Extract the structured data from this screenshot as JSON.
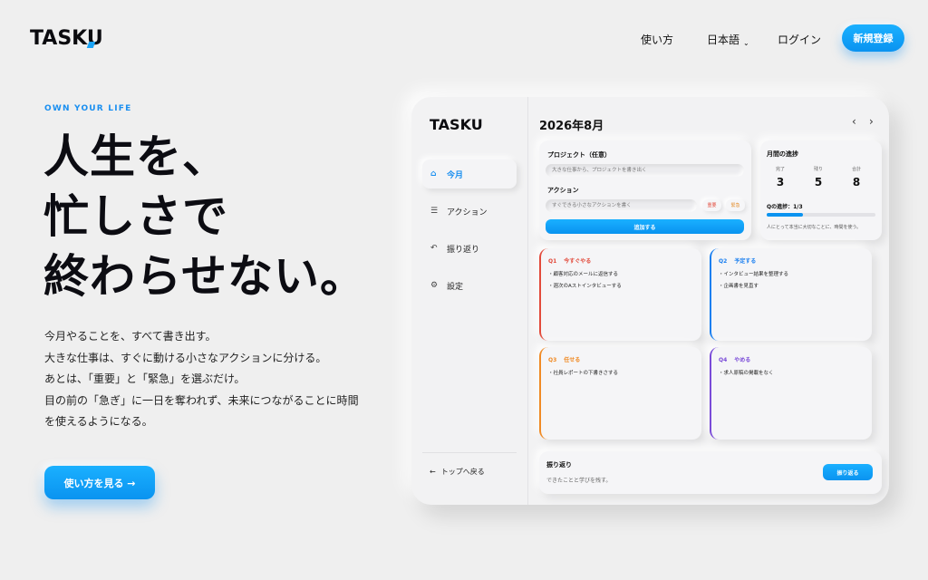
{
  "brand": {
    "logo_pre": "TASK",
    "logo_accent": "U"
  },
  "nav": {
    "how_to": "使い方",
    "language": "日本語",
    "login": "ログイン",
    "signup": "新規登録"
  },
  "hero": {
    "tagline": "OWN YOUR LIFE",
    "headline": [
      "人生を、",
      "忙しさで",
      "終わらせない。"
    ],
    "description": [
      "今月やることを、すべて書き出す。",
      "大きな仕事は、すぐに動ける小さなアクションに分ける。",
      "あとは、「重要」と「緊急」を選ぶだけ。",
      "目の前の「急ぎ」に一日を奪われず、未来につながることに時間",
      "を使えるようになる。"
    ],
    "cta": "使い方を見る →"
  },
  "app": {
    "logo": "TASKU",
    "sidebar": {
      "items": [
        {
          "icon": "home-icon",
          "label": "今月"
        },
        {
          "icon": "list-icon",
          "label": "アクション"
        },
        {
          "icon": "review-icon",
          "label": "振り返り"
        },
        {
          "icon": "gear-icon",
          "label": "設定"
        }
      ],
      "back": "トップへ戻る"
    },
    "month": "2026年8月",
    "form": {
      "project_label": "プロジェクト（任意）",
      "project_placeholder": "大きな仕事から、プロジェクトを書き出く",
      "action_label": "アクション",
      "action_placeholder": "すぐできる小さなアクションを書く",
      "tag_important": "重要",
      "tag_urgent": "緊急",
      "add_button": "追加する"
    },
    "progress": {
      "title": "月間の進捗",
      "stats": [
        {
          "label": "完了",
          "value": "3"
        },
        {
          "label": "残り",
          "value": "5"
        },
        {
          "label": "合計",
          "value": "8"
        }
      ],
      "q_progress": "Qの進捗：1/3",
      "q_fraction": 0.33,
      "note": "人にとって本当に大切なことに、時間を使う。"
    },
    "quadrants": [
      {
        "code": "Q1",
        "title": "今すぐやる",
        "items": [
          "顧客対応のメールに返信する",
          "週次のAストインタビューする"
        ]
      },
      {
        "code": "Q2",
        "title": "予定する",
        "items": [
          "インタビュー結果を整理する",
          "企画書を見直す"
        ]
      },
      {
        "code": "Q3",
        "title": "任せる",
        "items": [
          "社員レポートの下書きさする"
        ]
      },
      {
        "code": "Q4",
        "title": "やめる",
        "items": [
          "求人原稿の掲載をなく"
        ]
      }
    ],
    "review": {
      "title": "振り返り",
      "subtitle": "できたことと学びを残す。",
      "button": "振り返る"
    }
  },
  "colors": {
    "accent": "#0a93f0",
    "q1": "#e24a3b",
    "q2": "#1a7ff0",
    "q3": "#f08a24",
    "q4": "#7a4bd8"
  }
}
